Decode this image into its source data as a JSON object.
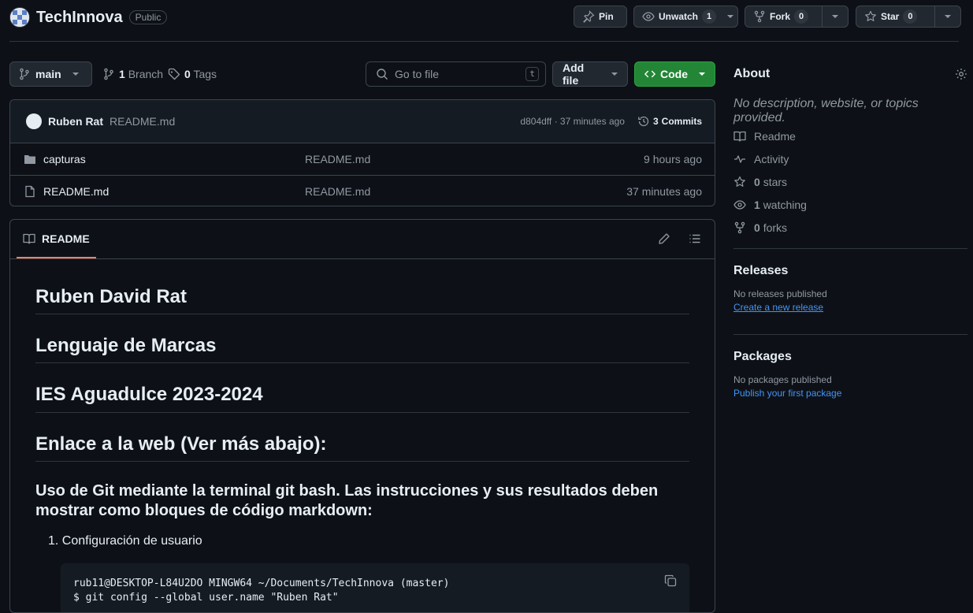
{
  "repo": {
    "name": "TechInnova",
    "visibility": "Public"
  },
  "header_actions": {
    "pin": "Pin",
    "unwatch": "Unwatch",
    "watch_count": "1",
    "fork": "Fork",
    "fork_count": "0",
    "star": "Star",
    "star_count": "0"
  },
  "toolbar": {
    "branch": "main",
    "branches_count": "1",
    "branches_label": "Branch",
    "tags_count": "0",
    "tags_label": "Tags",
    "search_placeholder": "Go to file",
    "search_key": "t",
    "add_file": "Add file",
    "code": "Code"
  },
  "commit": {
    "author": "Ruben Rat",
    "message": "README.md",
    "hash_time": "d804dff · 37 minutes ago",
    "commits_count": "3",
    "commits_label": "Commits"
  },
  "files": [
    {
      "type": "folder",
      "name": "capturas",
      "message": "README.md",
      "time": "9 hours ago"
    },
    {
      "type": "file",
      "name": "README.md",
      "message": "README.md",
      "time": "37 minutes ago"
    }
  ],
  "readme": {
    "tab": "README",
    "h1": [
      "Ruben David Rat",
      "Lenguaje de Marcas",
      "IES Aguadulce 2023-2024",
      "Enlace a la web (Ver más abajo):"
    ],
    "h2": "Uso de Git mediante la terminal git bash. Las instrucciones y sus resultados deben mostrar como bloques de código markdown:",
    "list_item_1": "Configuración de usuario",
    "code_line_1": "rub11@DESKTOP-L84U2DO MINGW64 ~/Documents/TechInnova (master)",
    "code_line_2": "$ git config --global user.name \"Ruben Rat\""
  },
  "about": {
    "title": "About",
    "description": "No description, website, or topics provided.",
    "readme": "Readme",
    "activity": "Activity",
    "stars_count": "0",
    "stars_label": "stars",
    "watching_count": "1",
    "watching_label": "watching",
    "forks_count": "0",
    "forks_label": "forks"
  },
  "releases": {
    "title": "Releases",
    "empty": "No releases published",
    "link": "Create a new release"
  },
  "packages": {
    "title": "Packages",
    "empty": "No packages published",
    "link": "Publish your first package"
  },
  "colors": {
    "accent_green": "#238636",
    "link_blue": "#4493f8",
    "tab_underline": "#f78166",
    "bg": "#0d1117"
  }
}
